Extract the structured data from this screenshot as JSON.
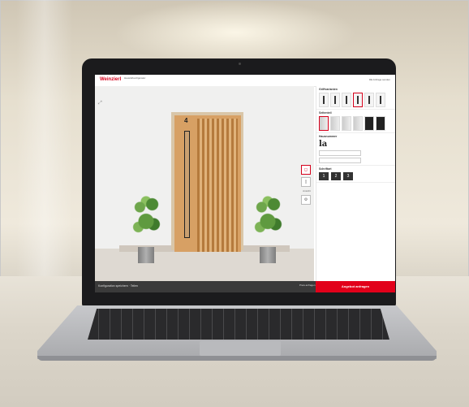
{
  "app": {
    "logo_text": "Weinzierl",
    "logo_subtitle": "Haustürkonfigurator",
    "top_right": "DE  Anfrage senden",
    "expand_icon": "expand-icon"
  },
  "door": {
    "house_number": "4",
    "colors": {
      "wood": "#d7a064",
      "frame": "#d9c6a8",
      "handle": "#222222"
    }
  },
  "side_tools": [
    {
      "label": "",
      "icon": "camera-icon",
      "active": true
    },
    {
      "label": "Ansicht",
      "icon": "door-icon",
      "active": false
    },
    {
      "label": "",
      "icon": "settings-icon",
      "active": false
    }
  ],
  "panel": {
    "sections": [
      {
        "title": "Griffvarianten"
      },
      {
        "title": "Seitenteil"
      },
      {
        "title": "Hausnummer"
      },
      {
        "title": "Schriftart"
      }
    ],
    "font_sample": "la",
    "number_samples": [
      "1",
      "2",
      "3"
    ]
  },
  "footer": {
    "left_text": "Konfiguration speichern · Teilen",
    "mid_text": "Preis anfragen",
    "cta_label": "Angebot anfragen"
  },
  "colors": {
    "accent": "#e2001a",
    "footer_bg": "#3a3a3a"
  }
}
